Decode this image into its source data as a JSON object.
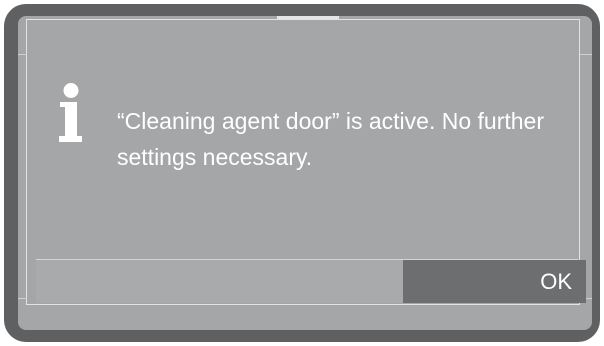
{
  "dialog": {
    "icon": "info-icon",
    "message": "“Cleaning agent door” is active. No further settings necessary."
  },
  "footer": {
    "ok_label": "OK"
  },
  "colors": {
    "bezel": "#5f6062",
    "screen": "#a5a6a8",
    "ok_button": "#6d6e70",
    "text": "#ffffff"
  }
}
